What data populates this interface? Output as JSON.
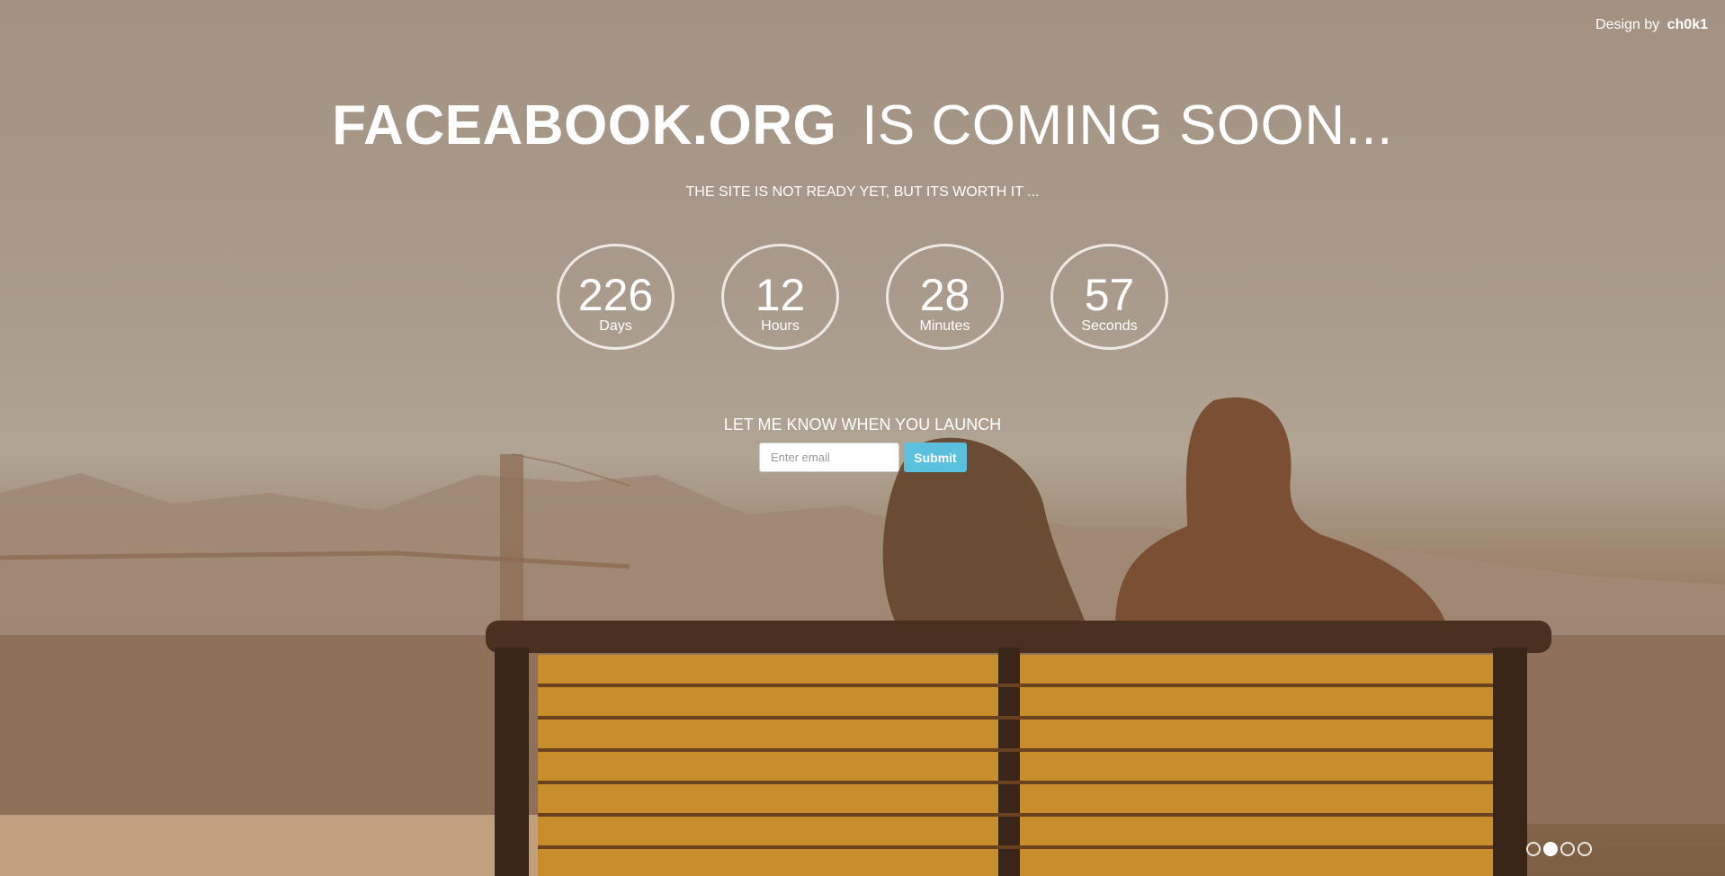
{
  "credit": {
    "prefix": "Design by",
    "author": "ch0k1"
  },
  "hero": {
    "site": "FACEABOOK.ORG",
    "status": "IS COMING SOON...",
    "subtitle": "THE SITE IS NOT READY YET, BUT ITS WORTH IT ..."
  },
  "countdown": [
    {
      "value": "226",
      "label": "Days"
    },
    {
      "value": "12",
      "label": "Hours"
    },
    {
      "value": "28",
      "label": "Minutes"
    },
    {
      "value": "57",
      "label": "Seconds"
    }
  ],
  "notify": {
    "heading": "LET ME KNOW WHEN YOU LAUNCH",
    "email_placeholder": "Enter email",
    "submit_label": "Submit"
  },
  "slider": {
    "count": 4,
    "active_index": 1
  },
  "colors": {
    "accent": "#5bc0de"
  }
}
